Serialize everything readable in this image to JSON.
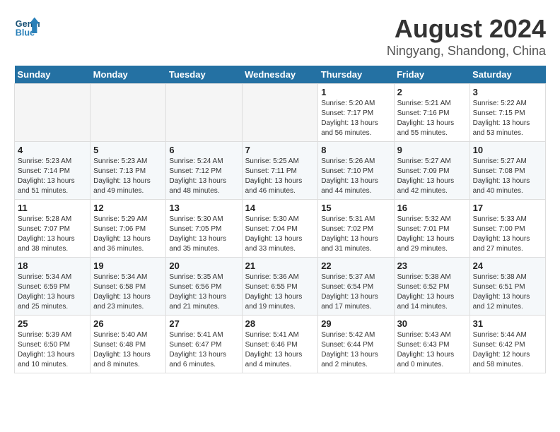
{
  "header": {
    "logo_line1": "General",
    "logo_line2": "Blue",
    "title": "August 2024",
    "subtitle": "Ningyang, Shandong, China"
  },
  "calendar": {
    "days_of_week": [
      "Sunday",
      "Monday",
      "Tuesday",
      "Wednesday",
      "Thursday",
      "Friday",
      "Saturday"
    ],
    "weeks": [
      [
        {
          "day": "",
          "info": ""
        },
        {
          "day": "",
          "info": ""
        },
        {
          "day": "",
          "info": ""
        },
        {
          "day": "",
          "info": ""
        },
        {
          "day": "1",
          "info": "Sunrise: 5:20 AM\nSunset: 7:17 PM\nDaylight: 13 hours\nand 56 minutes."
        },
        {
          "day": "2",
          "info": "Sunrise: 5:21 AM\nSunset: 7:16 PM\nDaylight: 13 hours\nand 55 minutes."
        },
        {
          "day": "3",
          "info": "Sunrise: 5:22 AM\nSunset: 7:15 PM\nDaylight: 13 hours\nand 53 minutes."
        }
      ],
      [
        {
          "day": "4",
          "info": "Sunrise: 5:23 AM\nSunset: 7:14 PM\nDaylight: 13 hours\nand 51 minutes."
        },
        {
          "day": "5",
          "info": "Sunrise: 5:23 AM\nSunset: 7:13 PM\nDaylight: 13 hours\nand 49 minutes."
        },
        {
          "day": "6",
          "info": "Sunrise: 5:24 AM\nSunset: 7:12 PM\nDaylight: 13 hours\nand 48 minutes."
        },
        {
          "day": "7",
          "info": "Sunrise: 5:25 AM\nSunset: 7:11 PM\nDaylight: 13 hours\nand 46 minutes."
        },
        {
          "day": "8",
          "info": "Sunrise: 5:26 AM\nSunset: 7:10 PM\nDaylight: 13 hours\nand 44 minutes."
        },
        {
          "day": "9",
          "info": "Sunrise: 5:27 AM\nSunset: 7:09 PM\nDaylight: 13 hours\nand 42 minutes."
        },
        {
          "day": "10",
          "info": "Sunrise: 5:27 AM\nSunset: 7:08 PM\nDaylight: 13 hours\nand 40 minutes."
        }
      ],
      [
        {
          "day": "11",
          "info": "Sunrise: 5:28 AM\nSunset: 7:07 PM\nDaylight: 13 hours\nand 38 minutes."
        },
        {
          "day": "12",
          "info": "Sunrise: 5:29 AM\nSunset: 7:06 PM\nDaylight: 13 hours\nand 36 minutes."
        },
        {
          "day": "13",
          "info": "Sunrise: 5:30 AM\nSunset: 7:05 PM\nDaylight: 13 hours\nand 35 minutes."
        },
        {
          "day": "14",
          "info": "Sunrise: 5:30 AM\nSunset: 7:04 PM\nDaylight: 13 hours\nand 33 minutes."
        },
        {
          "day": "15",
          "info": "Sunrise: 5:31 AM\nSunset: 7:02 PM\nDaylight: 13 hours\nand 31 minutes."
        },
        {
          "day": "16",
          "info": "Sunrise: 5:32 AM\nSunset: 7:01 PM\nDaylight: 13 hours\nand 29 minutes."
        },
        {
          "day": "17",
          "info": "Sunrise: 5:33 AM\nSunset: 7:00 PM\nDaylight: 13 hours\nand 27 minutes."
        }
      ],
      [
        {
          "day": "18",
          "info": "Sunrise: 5:34 AM\nSunset: 6:59 PM\nDaylight: 13 hours\nand 25 minutes."
        },
        {
          "day": "19",
          "info": "Sunrise: 5:34 AM\nSunset: 6:58 PM\nDaylight: 13 hours\nand 23 minutes."
        },
        {
          "day": "20",
          "info": "Sunrise: 5:35 AM\nSunset: 6:56 PM\nDaylight: 13 hours\nand 21 minutes."
        },
        {
          "day": "21",
          "info": "Sunrise: 5:36 AM\nSunset: 6:55 PM\nDaylight: 13 hours\nand 19 minutes."
        },
        {
          "day": "22",
          "info": "Sunrise: 5:37 AM\nSunset: 6:54 PM\nDaylight: 13 hours\nand 17 minutes."
        },
        {
          "day": "23",
          "info": "Sunrise: 5:38 AM\nSunset: 6:52 PM\nDaylight: 13 hours\nand 14 minutes."
        },
        {
          "day": "24",
          "info": "Sunrise: 5:38 AM\nSunset: 6:51 PM\nDaylight: 13 hours\nand 12 minutes."
        }
      ],
      [
        {
          "day": "25",
          "info": "Sunrise: 5:39 AM\nSunset: 6:50 PM\nDaylight: 13 hours\nand 10 minutes."
        },
        {
          "day": "26",
          "info": "Sunrise: 5:40 AM\nSunset: 6:48 PM\nDaylight: 13 hours\nand 8 minutes."
        },
        {
          "day": "27",
          "info": "Sunrise: 5:41 AM\nSunset: 6:47 PM\nDaylight: 13 hours\nand 6 minutes."
        },
        {
          "day": "28",
          "info": "Sunrise: 5:41 AM\nSunset: 6:46 PM\nDaylight: 13 hours\nand 4 minutes."
        },
        {
          "day": "29",
          "info": "Sunrise: 5:42 AM\nSunset: 6:44 PM\nDaylight: 13 hours\nand 2 minutes."
        },
        {
          "day": "30",
          "info": "Sunrise: 5:43 AM\nSunset: 6:43 PM\nDaylight: 13 hours\nand 0 minutes."
        },
        {
          "day": "31",
          "info": "Sunrise: 5:44 AM\nSunset: 6:42 PM\nDaylight: 12 hours\nand 58 minutes."
        }
      ]
    ]
  }
}
